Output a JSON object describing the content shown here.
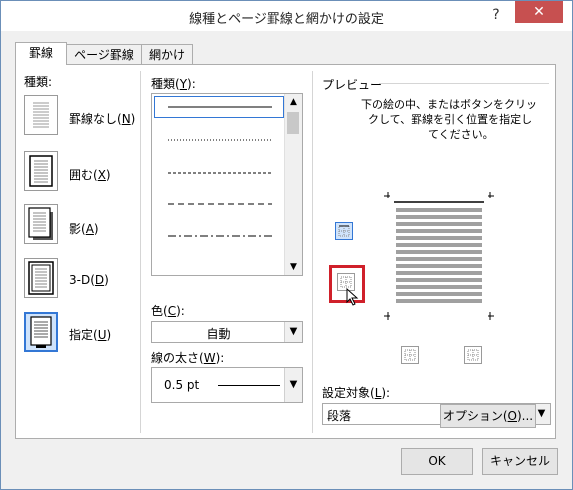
{
  "window": {
    "title": "線種とページ罫線と網かけの設定",
    "help_label": "?",
    "close_label": "✕"
  },
  "tabs": [
    {
      "label": "罫線",
      "active": true
    },
    {
      "label": "ページ罫線",
      "active": false
    },
    {
      "label": "網かけ",
      "active": false
    }
  ],
  "setting": {
    "label": "種類:",
    "presets": [
      {
        "label": "罫線なし(",
        "key": "N",
        "suffix": ")",
        "selected": false
      },
      {
        "label": "囲む(",
        "key": "X",
        "suffix": ")",
        "selected": false
      },
      {
        "label": "影(",
        "key": "A",
        "suffix": ")",
        "selected": false
      },
      {
        "label": "3-D(",
        "key": "D",
        "suffix": ")",
        "selected": false
      },
      {
        "label": "指定(",
        "key": "U",
        "suffix": ")",
        "selected": true
      }
    ]
  },
  "style": {
    "label": "種類(",
    "key": "Y",
    "suffix": "):",
    "line_styles": [
      "solid",
      "dotted",
      "dashed-small",
      "dashed",
      "dash-dot"
    ],
    "selected_index": 0
  },
  "color": {
    "label": "色(",
    "key": "C",
    "suffix": "):",
    "value": "自動"
  },
  "width": {
    "label": "線の太さ(",
    "key": "W",
    "suffix": "):",
    "value": "0.5 pt"
  },
  "preview": {
    "label": "プレビュー",
    "instruction_line1": "下の絵の中、またはボタンをクリッ",
    "instruction_line2": "クして、罫線を引く位置を指定し",
    "instruction_line3": "てください。"
  },
  "apply_to": {
    "label": "設定対象(",
    "key": "L",
    "suffix": "):",
    "value": "段落"
  },
  "options_button": {
    "label": "オプション(",
    "key": "O",
    "suffix": ")..."
  },
  "footer": {
    "ok_label": "OK",
    "cancel_label": "キャンセル"
  },
  "colors": {
    "accent": "#3377d5",
    "highlight_box": "#d0202a",
    "close_red": "#c75050"
  }
}
